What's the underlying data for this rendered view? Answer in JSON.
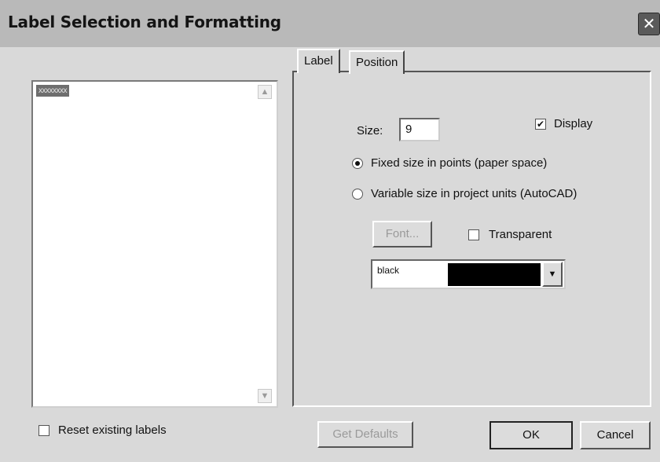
{
  "window": {
    "title": "Label Selection and Formatting",
    "close_glyph": "✕"
  },
  "label_list": {
    "items": [
      "xxxxxxxx"
    ]
  },
  "tabs": [
    {
      "label": "Label",
      "selected": true
    },
    {
      "label": "Position",
      "selected": false
    }
  ],
  "label_tab": {
    "size_label": "Size:",
    "size_value": "9",
    "display_label": "Display",
    "display_checked": true,
    "fixed_size_label": "Fixed size in points (paper space)",
    "variable_size_label": "Variable size in project units (AutoCAD)",
    "size_mode_selected": "fixed",
    "font_button": "Font...",
    "transparent_label": "Transparent",
    "transparent_checked": false,
    "color_value": "black",
    "color_hex": "#000000"
  },
  "footer": {
    "reset_label": "Reset existing labels",
    "reset_checked": false,
    "get_defaults": "Get Defaults",
    "ok": "OK",
    "cancel": "Cancel"
  }
}
